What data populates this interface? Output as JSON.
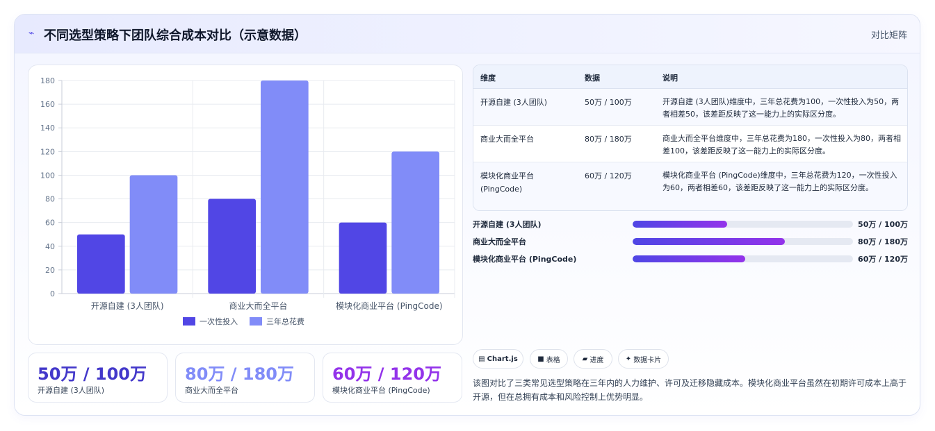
{
  "header": {
    "icon": "chart-icon",
    "title": "不同选型策略下团队综合成本对比（示意数据）",
    "tag": "对比矩阵"
  },
  "chart_data": {
    "type": "bar",
    "categories": [
      "开源自建 (3人团队)",
      "商业大而全平台",
      "模块化商业平台 (PingCode)"
    ],
    "series": [
      {
        "name": "一次性投入",
        "values": [
          50,
          80,
          60
        ],
        "color": "#5146e5"
      },
      {
        "name": "三年总花费",
        "values": [
          100,
          180,
          120
        ],
        "color": "#818cf8"
      }
    ],
    "ylim": [
      0,
      180
    ],
    "yticks": [
      0,
      20,
      40,
      60,
      80,
      100,
      120,
      140,
      160,
      180
    ],
    "grid": true,
    "legend": "bottom"
  },
  "stats": [
    {
      "value": "50万 / 100万",
      "label": "开源自建 (3人团队)",
      "color": "#4338ca"
    },
    {
      "value": "80万 / 180万",
      "label": "商业大而全平台",
      "color": "#818cf8"
    },
    {
      "value": "60万 / 120万",
      "label": "模块化商业平台 (PingCode)",
      "color": "#9333ea"
    }
  ],
  "table": {
    "headers": [
      "维度",
      "数据",
      "说明"
    ],
    "rows": [
      {
        "dim": "开源自建 (3人团队)",
        "data": "50万 / 100万",
        "desc": "开源自建 (3人团队)维度中，三年总花费为100，一次性投入为50，两者相差50，该差距反映了这一能力上的实际区分度。"
      },
      {
        "dim": "商业大而全平台",
        "data": "80万 / 180万",
        "desc": "商业大而全平台维度中，三年总花费为180，一次性投入为80，两者相差100，该差距反映了这一能力上的实际区分度。"
      },
      {
        "dim": "模块化商业平台 (PingCode)",
        "data": "60万 / 120万",
        "desc": "模块化商业平台 (PingCode)维度中，三年总花费为120，一次性投入为60，两者相差60，该差距反映了这一能力上的实际区分度。"
      }
    ]
  },
  "progress": [
    {
      "label": "开源自建 (3人团队)",
      "value": "50万 / 100万",
      "fraction": 0.43
    },
    {
      "label": "商业大而全平台",
      "value": "80万 / 180万",
      "fraction": 0.69
    },
    {
      "label": "模块化商业平台 (PingCode)",
      "value": "60万 / 120万",
      "fraction": 0.51
    }
  ],
  "chips": [
    {
      "icon": "▤",
      "label": "Chart.js"
    },
    {
      "icon": "■",
      "label": "表格"
    },
    {
      "icon": "▰",
      "label": "进度"
    },
    {
      "icon": "✦",
      "label": "数据卡片"
    }
  ],
  "note": "该图对比了三类常见选型策略在三年内的人力维护、许可及迁移隐藏成本。模块化商业平台虽然在初期许可成本上高于开源，但在总拥有成本和风险控制上优势明显。"
}
